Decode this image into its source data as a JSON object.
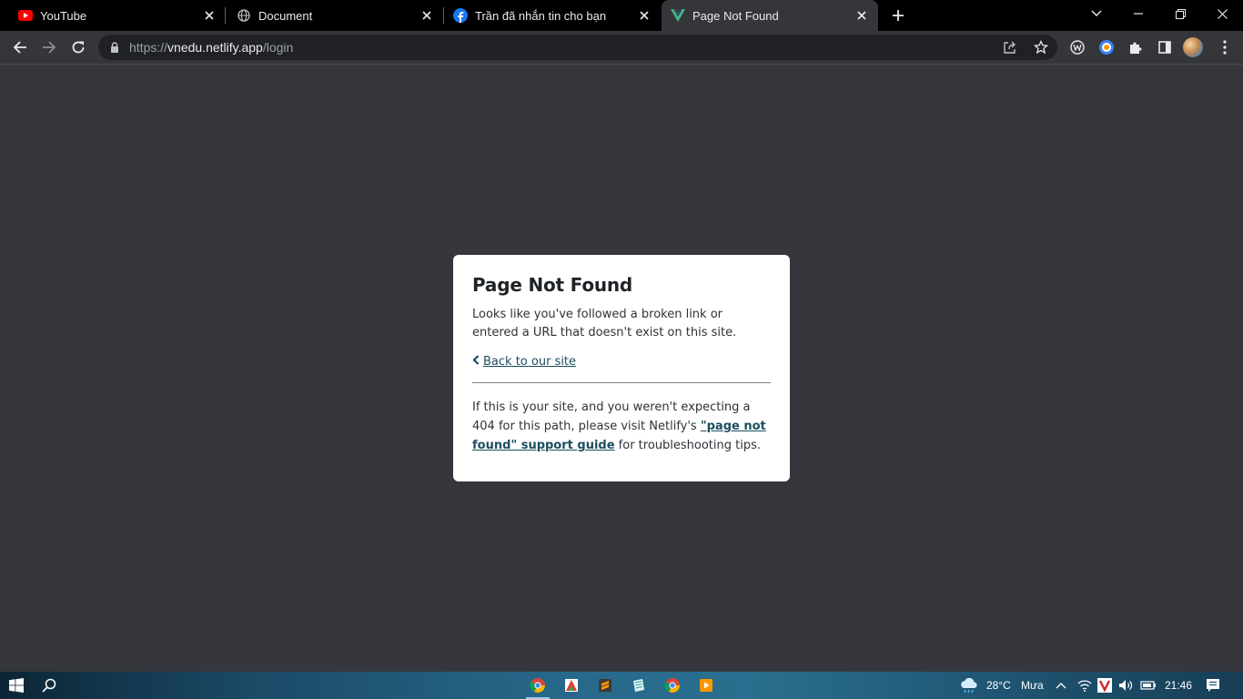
{
  "browser": {
    "tabs": [
      {
        "title": "YouTube",
        "icon": "youtube-icon",
        "active": false
      },
      {
        "title": "Document",
        "icon": "globe-icon",
        "active": false
      },
      {
        "title": "Trần đã nhắn tin cho bạn",
        "icon": "facebook-icon",
        "active": false
      },
      {
        "title": "Page Not Found",
        "icon": "vue-icon",
        "active": true
      }
    ],
    "address": {
      "scheme": "https://",
      "host": "vnedu.netlify.app",
      "path": "/login"
    }
  },
  "page": {
    "title": "Page Not Found",
    "message": "Looks like you've followed a broken link or entered a URL that doesn't exist on this site.",
    "back_link": "Back to our site",
    "fine_before": "If this is your site, and you weren't expecting a 404 for this path, please visit Netlify's ",
    "fine_link": "\"page not found\" support guide",
    "fine_after": " for troubleshooting tips."
  },
  "taskbar": {
    "weather_temp": "28°C",
    "weather_desc": "Mưa",
    "time": "21:46"
  },
  "colors": {
    "page_bg": "#35373d",
    "card_bg": "#ffffff",
    "link": "#1d4d5f",
    "tabstrip": "#000000",
    "toolbar": "#35363a"
  }
}
